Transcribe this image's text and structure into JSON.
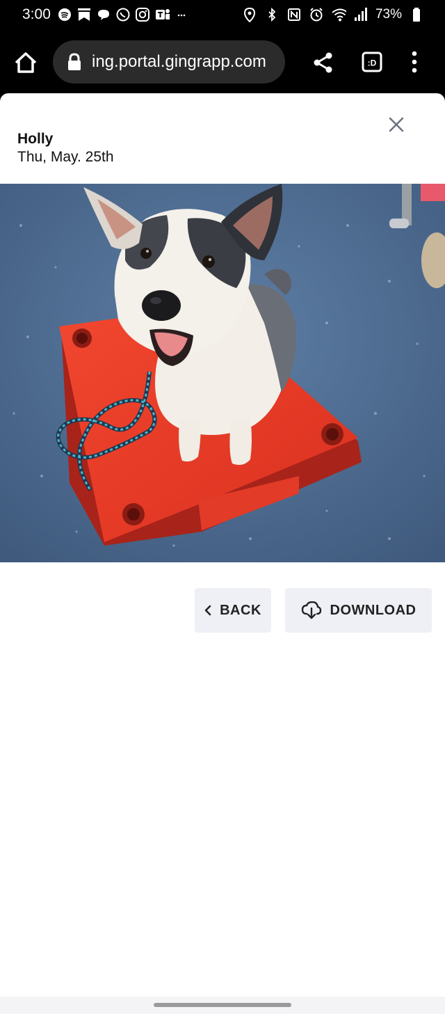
{
  "status_bar": {
    "time": "3:00",
    "battery": "73%",
    "left_icons": [
      "spotify-icon",
      "bookmark-icon",
      "chat-icon",
      "whatsapp-icon",
      "instagram-icon",
      "teams-icon",
      "more-dots-icon"
    ],
    "right_icons": [
      "location-icon",
      "bluetooth-icon",
      "nfc-icon",
      "alarm-icon",
      "wifi-icon",
      "signal-icon",
      "battery-icon"
    ]
  },
  "browser": {
    "url": "ing.portal.gingrapp.com",
    "tab_indicator": ":D"
  },
  "modal": {
    "name": "Holly",
    "date": "Thu, May. 25th",
    "photo_label": "",
    "back_label": "BACK",
    "download_label": "DOWNLOAD"
  },
  "colors": {
    "button_bg": "#eef0f6",
    "platform_red": "#e8392c",
    "floor_blue": "#4f6f94"
  }
}
